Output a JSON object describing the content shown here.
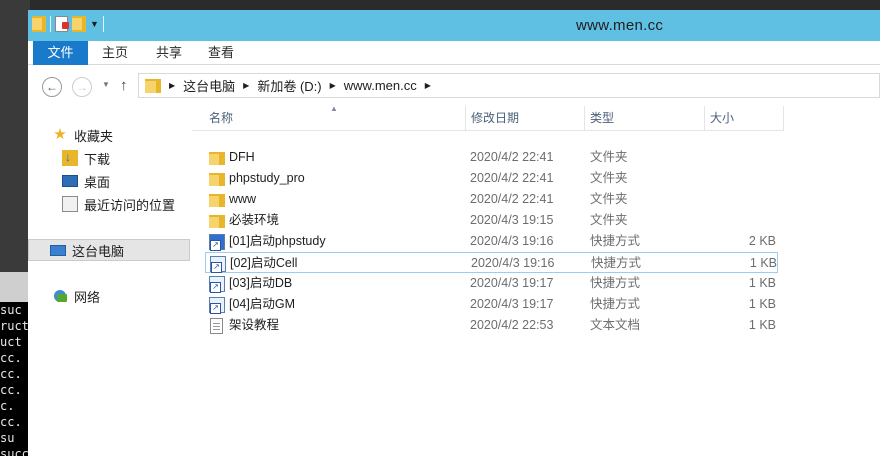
{
  "window": {
    "title": "www.men.cc"
  },
  "console": {
    "lines": [
      " suc",
      "ruct",
      "uct",
      "cc.",
      "cc.",
      "cc.",
      "c.",
      "cc.",
      "  su",
      "succ"
    ]
  },
  "ribbon": {
    "tabs": [
      "文件",
      "主页",
      "共享",
      "查看"
    ]
  },
  "address": {
    "crumbs": [
      "这台电脑",
      "新加卷 (D:)",
      "www.men.cc"
    ]
  },
  "nav": {
    "favorites_label": "收藏夹",
    "favorites": [
      "下载",
      "桌面",
      "最近访问的位置"
    ],
    "this_pc_label": "这台电脑",
    "network_label": "网络"
  },
  "columns": {
    "name": "名称",
    "date": "修改日期",
    "type": "类型",
    "size": "大小"
  },
  "files": [
    {
      "name": "DFH",
      "date": "2020/4/2 22:41",
      "type": "文件夹",
      "size": "",
      "icon": "folder-icon"
    },
    {
      "name": "phpstudy_pro",
      "date": "2020/4/2 22:41",
      "type": "文件夹",
      "size": "",
      "icon": "folder-icon"
    },
    {
      "name": "www",
      "date": "2020/4/2 22:41",
      "type": "文件夹",
      "size": "",
      "icon": "folder-icon"
    },
    {
      "name": "必装环境",
      "date": "2020/4/3 19:15",
      "type": "文件夹",
      "size": "",
      "icon": "folder-icon"
    },
    {
      "name": "[01]启动phpstudy",
      "date": "2020/4/3 19:16",
      "type": "快捷方式",
      "size": "2 KB",
      "icon": "shortcut-icon"
    },
    {
      "name": "[02]启动Cell",
      "date": "2020/4/3 19:16",
      "type": "快捷方式",
      "size": "1 KB",
      "icon": "shortcut-icon"
    },
    {
      "name": "[03]启动DB",
      "date": "2020/4/3 19:17",
      "type": "快捷方式",
      "size": "1 KB",
      "icon": "shortcut-icon"
    },
    {
      "name": "[04]启动GM",
      "date": "2020/4/3 19:17",
      "type": "快捷方式",
      "size": "1 KB",
      "icon": "shortcut-icon"
    },
    {
      "name": "架设教程",
      "date": "2020/4/2 22:53",
      "type": "文本文档",
      "size": "1 KB",
      "icon": "text-document-icon"
    }
  ]
}
